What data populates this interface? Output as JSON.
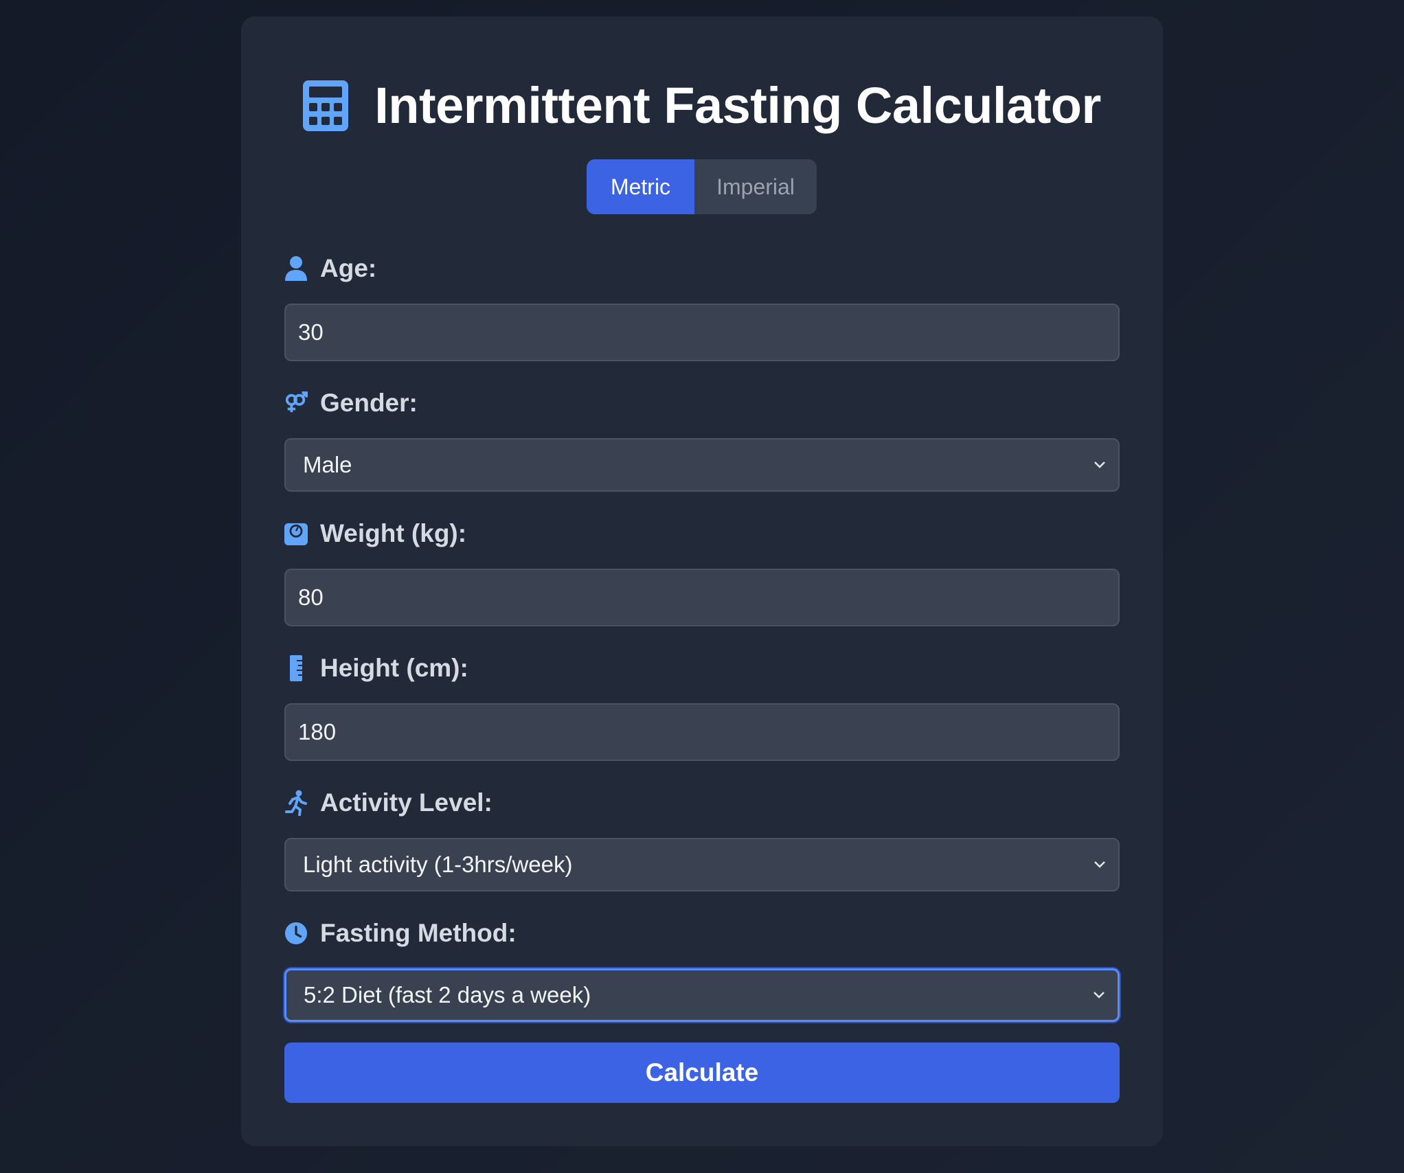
{
  "title": "Intermittent Fasting Calculator",
  "units": {
    "metric": "Metric",
    "imperial": "Imperial",
    "selected": "Metric"
  },
  "fields": {
    "age": {
      "label": "Age:",
      "value": "30"
    },
    "gender": {
      "label": "Gender:",
      "value": "Male"
    },
    "weight": {
      "label": "Weight (kg):",
      "value": "80"
    },
    "height": {
      "label": "Height (cm):",
      "value": "180"
    },
    "activity": {
      "label": "Activity Level:",
      "value": "Light activity (1-3hrs/week)"
    },
    "fasting": {
      "label": "Fasting Method:",
      "value": "5:2 Diet (fast 2 days a week)"
    }
  },
  "calculate_label": "Calculate",
  "icons": [
    "calculator-icon",
    "user-icon",
    "venus-mars-icon",
    "weight-scale-icon",
    "ruler-icon",
    "running-icon",
    "clock-icon",
    "chevron-down-icon"
  ],
  "colors": {
    "accent": "#3b63e4",
    "icon": "#60a5fa",
    "card": "#222938",
    "field": "#3a4150"
  }
}
